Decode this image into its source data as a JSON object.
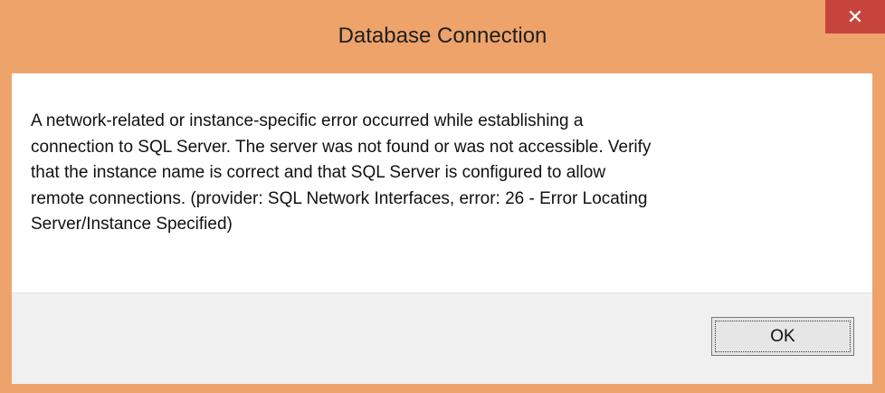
{
  "window": {
    "title": "Database Connection",
    "close_glyph": "✕",
    "close_icon": "close-icon",
    "frame_color": "#eea36b",
    "close_color": "#c7443c"
  },
  "dialog": {
    "message": "A network-related or instance-specific error occurred while establishing a\nconnection to SQL Server. The server was not found or was not accessible. Verify\nthat the instance name is correct and that SQL Server is configured to allow\nremote connections. (provider: SQL Network Interfaces, error: 26 - Error Locating\nServer/Instance Specified)",
    "ok_label": "OK"
  }
}
